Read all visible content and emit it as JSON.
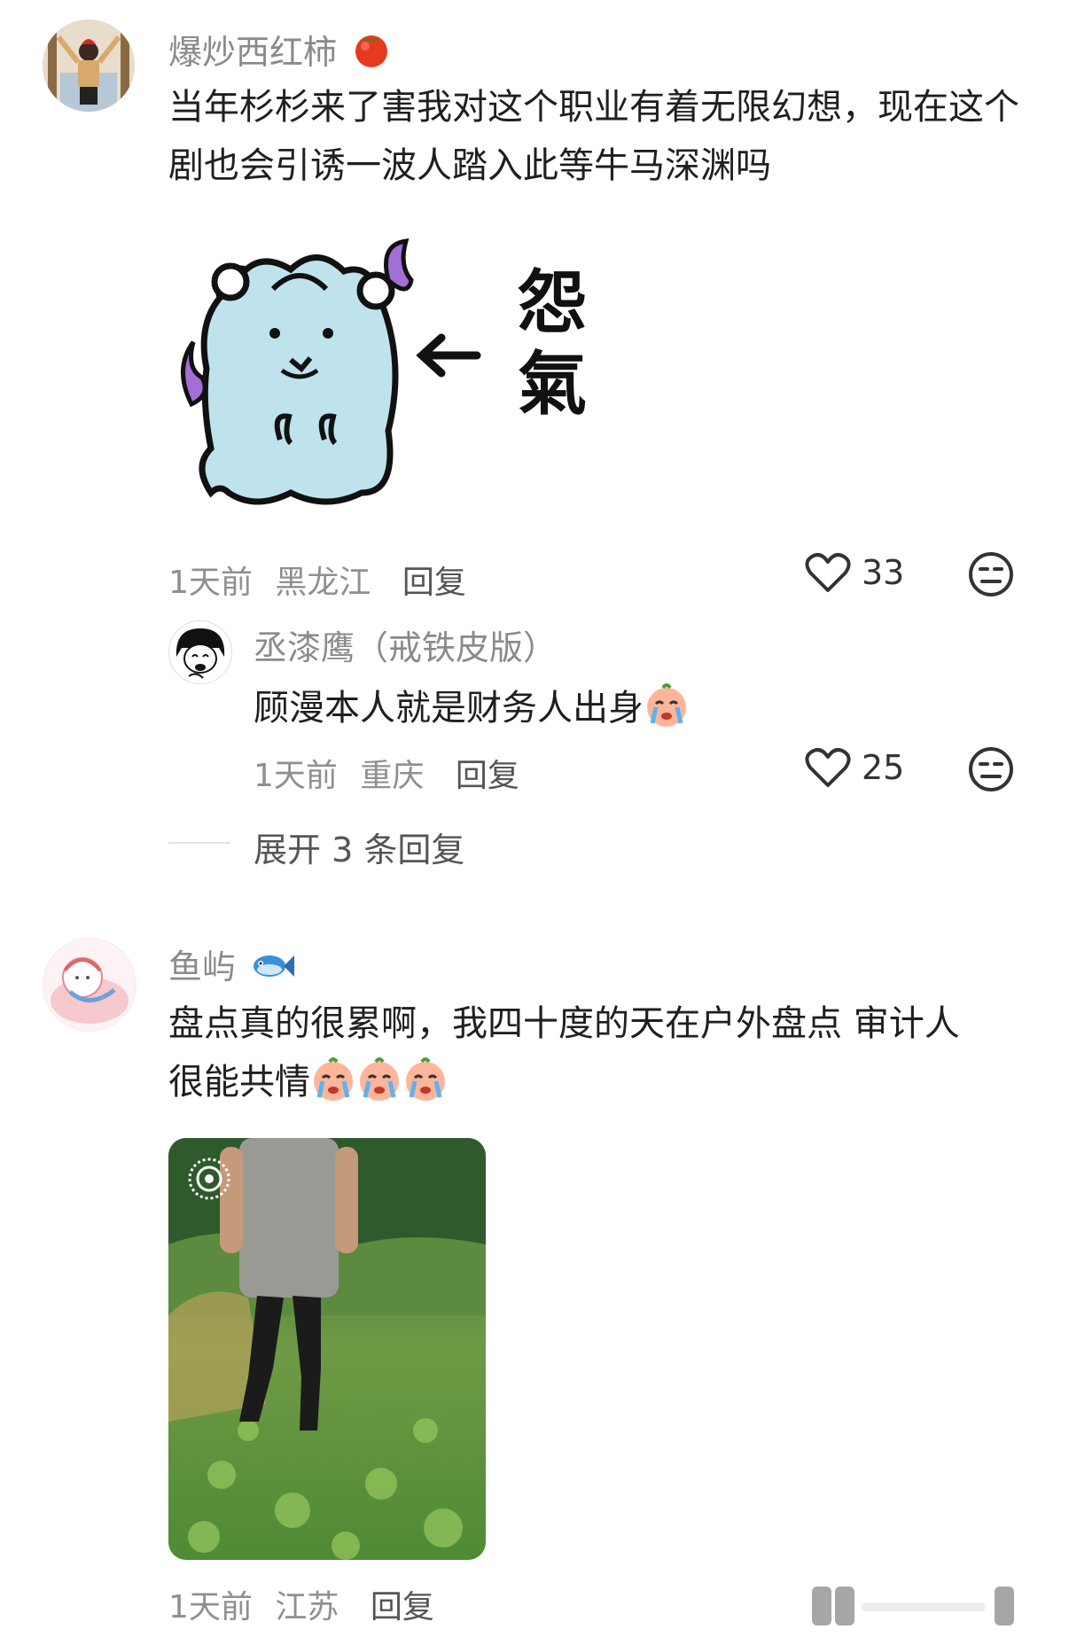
{
  "comments": [
    {
      "username": "爆炒西红柿",
      "username_emoji": "tomato-icon",
      "text": "当年杉杉来了害我对这个职业有着无限幻想，现在这个剧也会引诱一波人踏入此等牛马深渊吗",
      "sticker_text": "怨氣",
      "time": "1天前",
      "location": "黑龙江",
      "reply_label": "回复",
      "likes": "33",
      "replies": [
        {
          "username": "丞漆鹰（戒铁皮版）",
          "text": "顾漫本人就是财务人出身",
          "time": "1天前",
          "location": "重庆",
          "reply_label": "回复",
          "likes": "25"
        }
      ],
      "expand_label": "展开 3 条回复"
    },
    {
      "username": "鱼屿",
      "username_emoji": "fish-icon",
      "text_line1": "盘点真的很累啊，我四十度的天在户外盘点 审计人",
      "text_line2": "很能共情",
      "time": "1天前",
      "location": "江苏",
      "reply_label": "回复"
    }
  ],
  "colors": {
    "accent_gray": "#8a8a8a",
    "text": "#1f1f1f"
  }
}
